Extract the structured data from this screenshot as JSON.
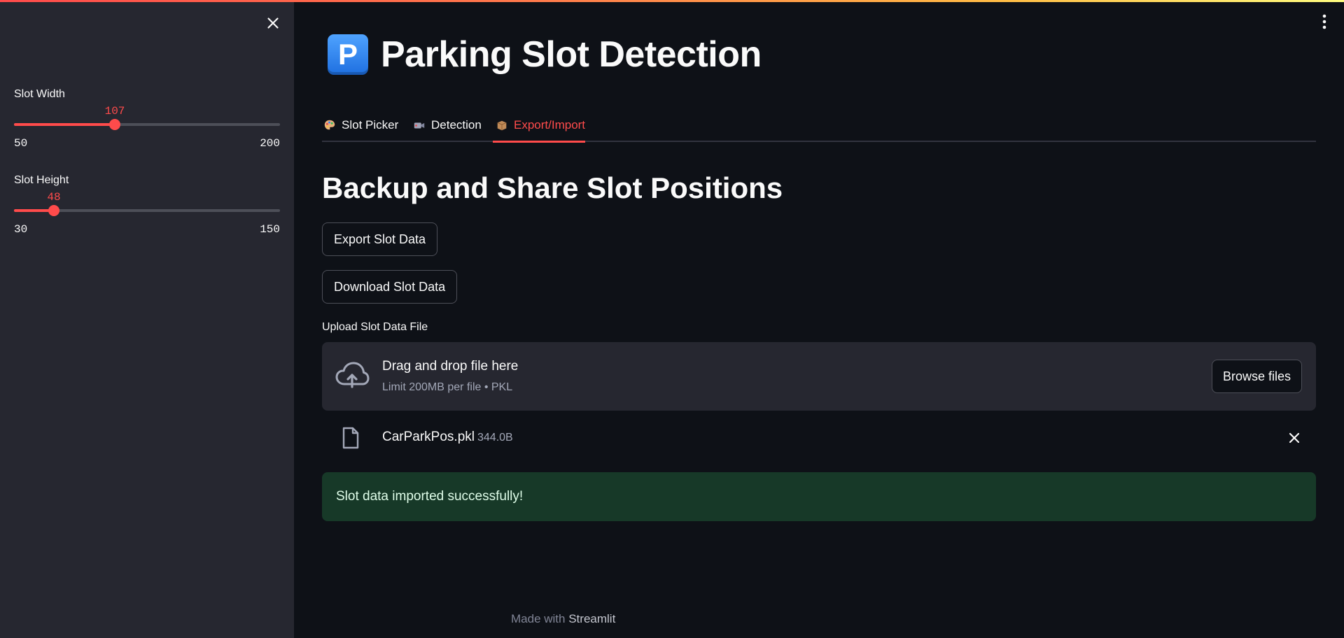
{
  "app": {
    "title": "Parking Slot Detection",
    "title_icon_glyph": "P",
    "title_icon": "parking-p-icon",
    "accent_color": "#ff4b4b",
    "background_color": "#0e1117",
    "sidebar_color": "#262730"
  },
  "sidebar": {
    "close_icon": "close-icon",
    "sliders": [
      {
        "label": "Slot Width",
        "value": 107,
        "value_text": "107",
        "min": 50,
        "min_text": "50",
        "max": 200,
        "max_text": "200"
      },
      {
        "label": "Slot Height",
        "value": 48,
        "value_text": "48",
        "min": 30,
        "min_text": "30",
        "max": 150,
        "max_text": "150"
      }
    ]
  },
  "tabs": [
    {
      "label": "Slot Picker",
      "icon": "palette-icon",
      "active": false
    },
    {
      "label": "Detection",
      "icon": "video-camera-icon",
      "active": false
    },
    {
      "label": "Export/Import",
      "icon": "package-icon",
      "active": true
    }
  ],
  "export_import": {
    "heading": "Backup and Share Slot Positions",
    "export_button": "Export Slot Data",
    "download_button": "Download Slot Data",
    "uploader": {
      "label": "Upload Slot Data File",
      "drop_title": "Drag and drop file here",
      "drop_subtitle": "Limit 200MB per file • PKL",
      "browse_button": "Browse files"
    },
    "uploaded_file": {
      "name": "CarParkPos.pkl",
      "size": "344.0B"
    },
    "success_message": "Slot data imported successfully!"
  },
  "footer": {
    "prefix": "Made with",
    "brand": "Streamlit"
  }
}
